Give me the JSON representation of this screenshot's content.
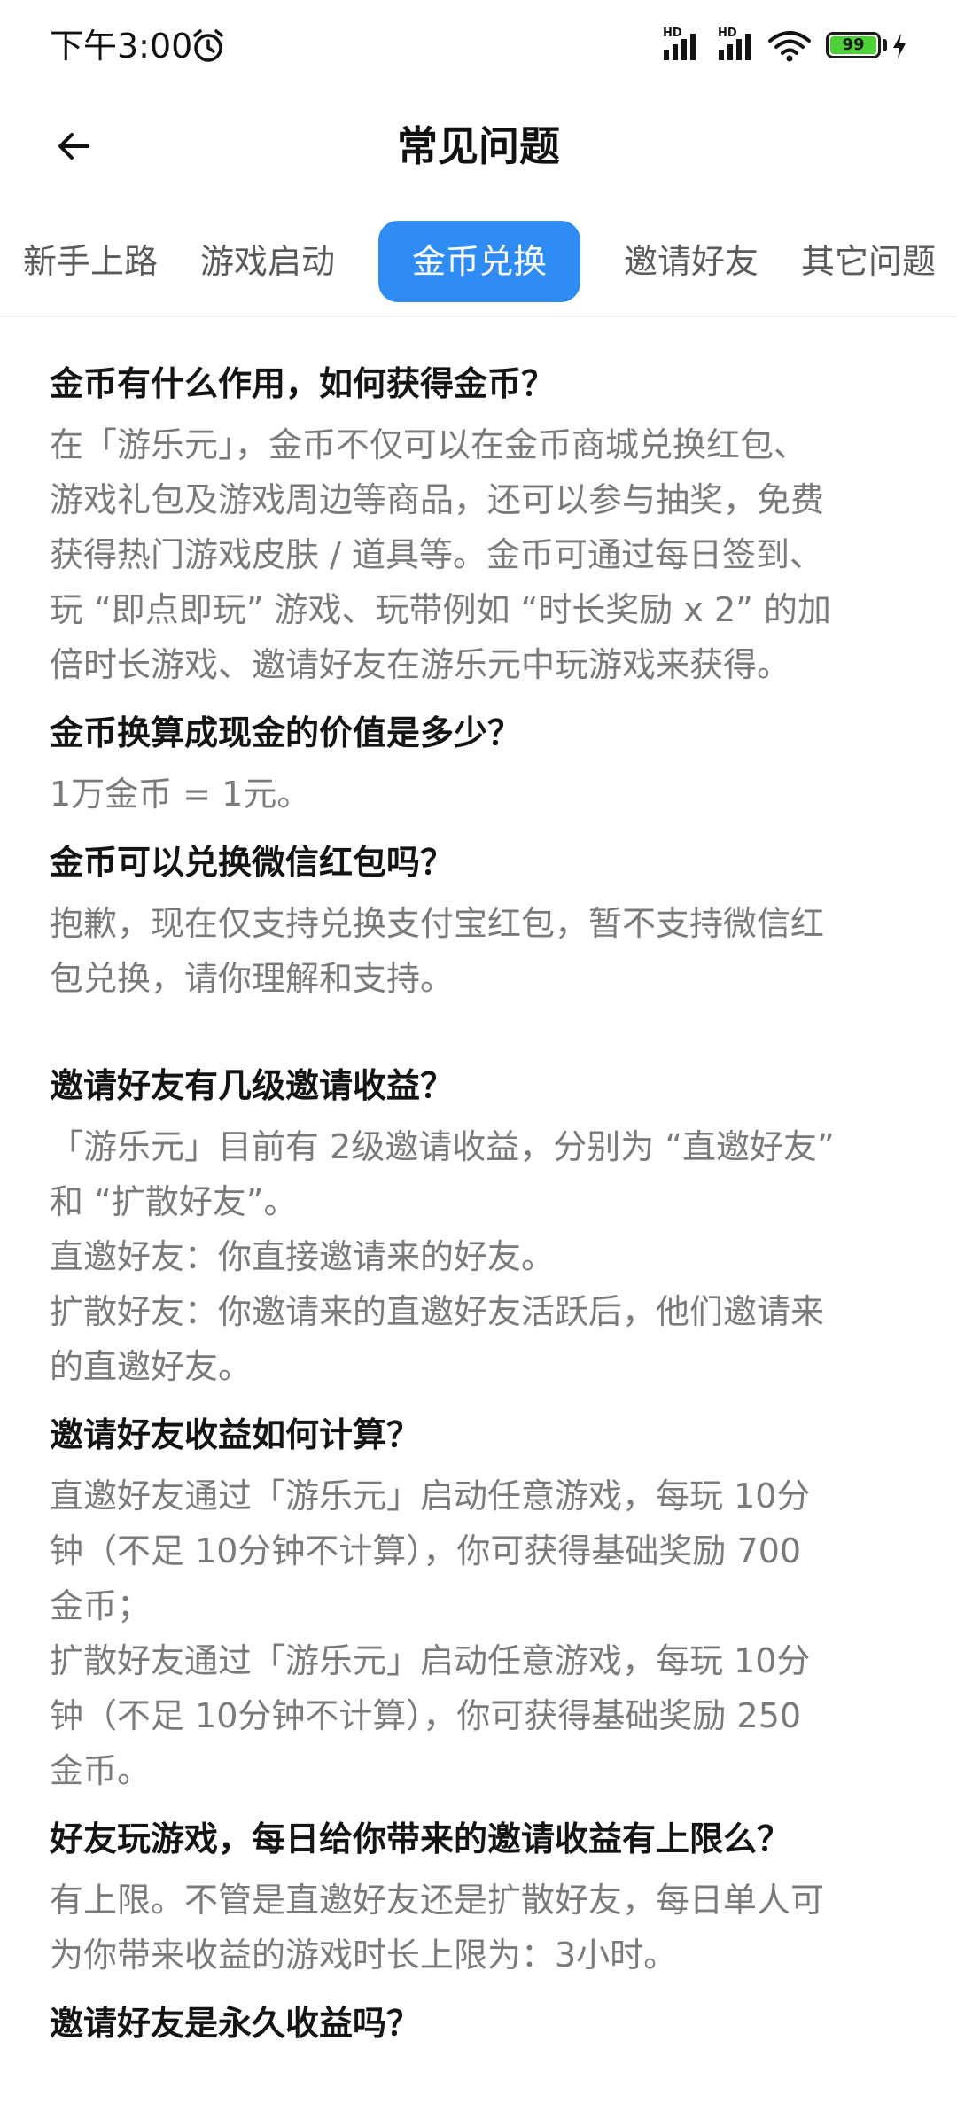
{
  "status_bar": {
    "time": "下午3:00",
    "battery_level": "99",
    "hd_label": "HD"
  },
  "header": {
    "title": "常见问题"
  },
  "tabs": [
    {
      "label": "新手上路",
      "active": false
    },
    {
      "label": "游戏启动",
      "active": false
    },
    {
      "label": "金币兑换",
      "active": true
    },
    {
      "label": "邀请好友",
      "active": false
    },
    {
      "label": "其它问题",
      "active": false
    }
  ],
  "faq": [
    {
      "question": "金币有什么作用，如何获得金币？",
      "answer": "在「游乐元」，金币不仅可以在金币商城兑换红包、\n游戏礼包及游戏周边等商品，还可以参与抽奖，免费\n获得热门游戏皮肤 / 道具等。金币可通过每日签到、\n玩 “即点即玩” 游戏、玩带例如 “时长奖励 x 2” 的加\n倍时长游戏、邀请好友在游乐元中玩游戏来获得。"
    },
    {
      "question": "金币换算成现金的价值是多少？",
      "answer": "1万金币 = 1元。"
    },
    {
      "question": "金币可以兑换微信红包吗？",
      "answer": "抱歉，现在仅支持兑换支付宝红包，暂不支持微信红\n包兑换，请你理解和支持。"
    },
    {
      "question": "邀请好友有几级邀请收益？",
      "answer": "「游乐元」目前有 2级邀请收益，分别为 “直邀好友”\n和 “扩散好友”。\n直邀好友：你直接邀请来的好友。\n扩散好友：你邀请来的直邀好友活跃后，他们邀请来\n的直邀好友。"
    },
    {
      "question": "邀请好友收益如何计算？",
      "answer": "直邀好友通过「游乐元」启动任意游戏，每玩 10分\n钟（不足 10分钟不计算），你可获得基础奖励 700\n金币；\n扩散好友通过「游乐元」启动任意游戏，每玩 10分\n钟（不足 10分钟不计算），你可获得基础奖励 250\n金币。"
    },
    {
      "question": "好友玩游戏，每日给你带来的邀请收益有上限么？",
      "answer": "有上限。不管是直邀好友还是扩散好友，每日单人可\n为你带来收益的游戏时长上限为：3小时。"
    },
    {
      "question": "邀请好友是永久收益吗？",
      "answer": ""
    }
  ]
}
